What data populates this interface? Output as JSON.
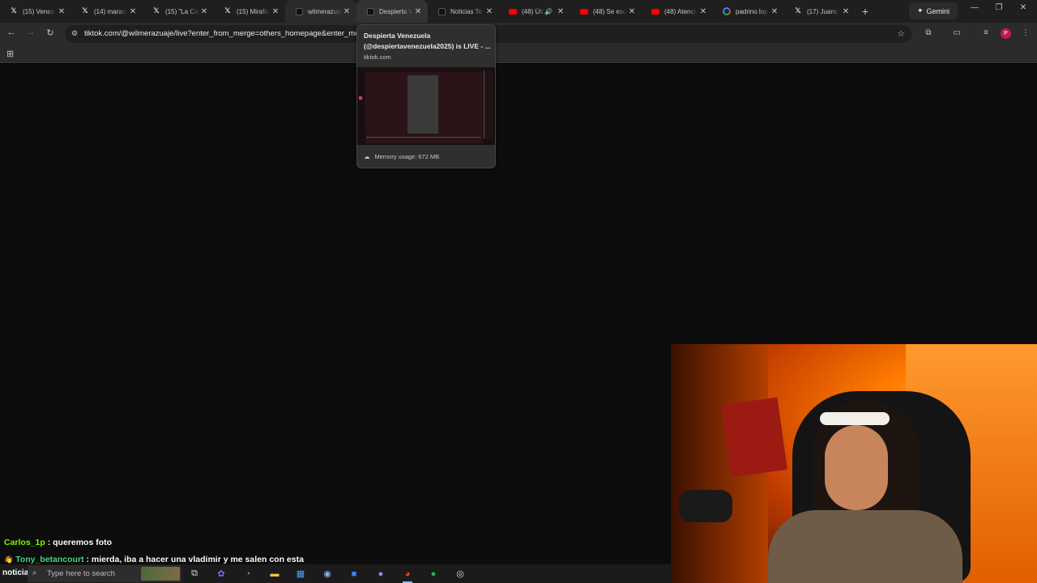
{
  "tabs": [
    {
      "title": "(15) Venez",
      "icon": "x-icon",
      "state": "normal"
    },
    {
      "title": "(14) maracu",
      "icon": "x-icon",
      "state": "normal"
    },
    {
      "title": "(15) \"La Car",
      "icon": "x-icon",
      "state": "normal"
    },
    {
      "title": "(15) Mirafic",
      "icon": "x-icon",
      "state": "normal"
    },
    {
      "title": "wilmerazuaj",
      "icon": "tiktok-icon",
      "state": "active"
    },
    {
      "title": "Despierta V",
      "icon": "tiktok-icon",
      "state": "hover"
    },
    {
      "title": "Noticias Te",
      "icon": "tiktok-icon",
      "state": "normal"
    },
    {
      "title": "(48) Últi",
      "icon": "youtube-icon",
      "state": "normal",
      "audio": true
    },
    {
      "title": "(48) Se esc",
      "icon": "youtube-icon",
      "state": "normal"
    },
    {
      "title": "(48) Atenci",
      "icon": "youtube-icon",
      "state": "normal"
    },
    {
      "title": "padrino lop",
      "icon": "google-icon",
      "state": "normal"
    },
    {
      "title": "(17) Juanc",
      "icon": "x-icon",
      "state": "normal"
    }
  ],
  "new_tab_label": "+",
  "gemini_label": "Gemini",
  "address_bar": {
    "url": "tiktok.com/@wilmerazuaje/live?enter_from_merge=others_homepage&enter_met"
  },
  "hover_card": {
    "title": "Despierta Venezuela (@despiertavenezuela2025) is LIVE - ...",
    "domain": "tiktok.com",
    "memory": "Memory usage: 672 MB"
  },
  "profile_initial": "P",
  "chat": [
    {
      "user": "Carlos_1p",
      "message": ": queremos foto"
    },
    {
      "user": "Tony_betancourt",
      "message": ": mierda, iba a hacer una vladimir y me salen con esta"
    }
  ],
  "taskbar": {
    "label": "noticia",
    "search_placeholder": "Type here to search",
    "apps": [
      "task-view-icon",
      "copilot-icon",
      "edge-icon",
      "file-explorer-icon",
      "store-icon",
      "steam-icon",
      "app-icon",
      "discord-icon",
      "chrome-icon",
      "spotify-icon",
      "obs-icon"
    ]
  },
  "colors": {
    "tiktok_accent": "#fe2c55",
    "youtube": "#ff0000",
    "chat_user_1": "#7cfc00",
    "chat_user_2": "#3ddc84"
  }
}
